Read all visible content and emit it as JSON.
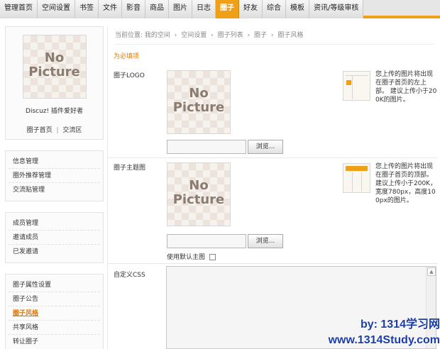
{
  "nav": {
    "tabs": [
      "管理首页",
      "空间设置",
      "书签",
      "文件",
      "影音",
      "商品",
      "图片",
      "日志",
      "圈子",
      "好友",
      "综合",
      "模板",
      "资讯/等级审核"
    ],
    "active_index": 8
  },
  "sidebar": {
    "avatar_text": [
      "No",
      "Picture"
    ],
    "group_name": "Discuz! 插件爱好者",
    "links": [
      "圈子首页",
      "交流区"
    ],
    "menu_groups": [
      [
        "信息管理",
        "圈外推荐管理",
        "交流贴管理"
      ],
      [
        "成员管理",
        "邀请成员",
        "已发邀请"
      ],
      [
        "圈子属性设置",
        "圈子公告",
        "圈子风格",
        "共享风格",
        "转让圈子"
      ]
    ],
    "active_item": "圈子风格"
  },
  "main": {
    "breadcrumb": [
      "当前位置: 我的空间",
      "空间设置",
      "圈子列表",
      "圈子",
      "圈子风格"
    ],
    "breadcrumb_sep": "›",
    "required_note": "为必填项",
    "logo": {
      "label": "圈子LOGO",
      "placeholder_text": [
        "No",
        "Picture"
      ],
      "browse_label": "浏览...",
      "hint": "您上传的图片将出现在圈子首页的左上部。 建议上传小于200K的图片。"
    },
    "theme": {
      "label": "圈子主题图",
      "placeholder_text": [
        "No",
        "Picture"
      ],
      "browse_label": "浏览...",
      "hint": "您上传的图片将出现在圈子首页的顶部。建议上传小于200K，宽度780px，高度100px的图片。",
      "default_label": "使用默认主图"
    },
    "css": {
      "label": "自定义CSS",
      "value": ""
    }
  },
  "watermark": {
    "line1": "by: 1314学习网",
    "line2": "www.1314Study.com"
  },
  "colors": {
    "accent": "#f0a018",
    "active_text": "#e07800",
    "watermark": "#1a3da8"
  }
}
